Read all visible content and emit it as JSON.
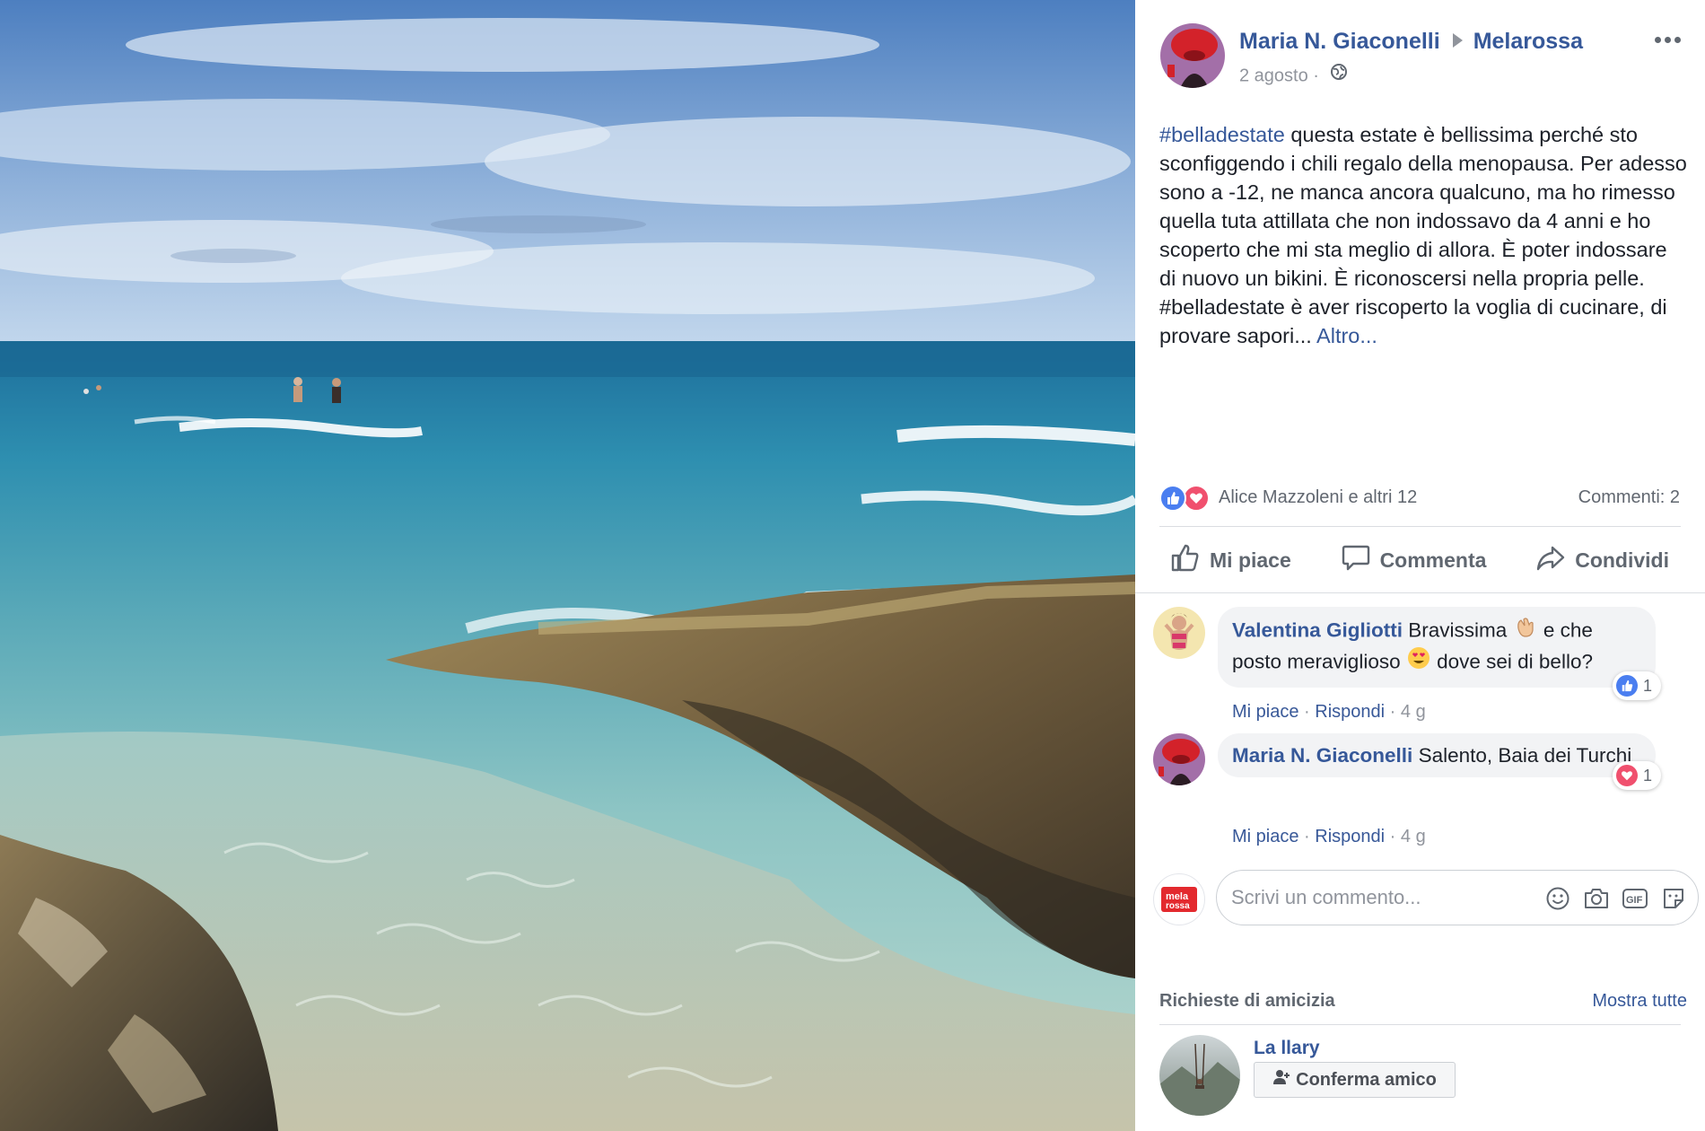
{
  "post": {
    "author": "Maria N. Giaconelli",
    "target": "Melarossa",
    "date": "2 agosto",
    "date_separator": "·",
    "text_tag1": "#belladestate",
    "text_part1": " questa estate è bellissima perché sto sconfiggendo i chili regalo della menopausa. Per adesso sono a -12, ne manca ancora qualcuno, ma ho rimesso quella tuta attillata che non indossavo da 4 anni e ho scoperto che mi sta meglio di allora. È poter indossare di nuovo un bikini. È riconoscersi nella propria pelle. #belladestate è aver riscoperto la voglia di cucinare, di provare sapori... ",
    "text_more": "Altro..."
  },
  "reactions": {
    "names": "Alice Mazzoleni e altri 12",
    "comments_count": "Commenti: 2"
  },
  "actions": {
    "like": "Mi piace",
    "comment": "Commenta",
    "share": "Condividi"
  },
  "comments": [
    {
      "author": "Valentina Gigliotti",
      "text_a": " Bravissima ",
      "text_b": " e che posto meraviglioso ",
      "text_c": " dove sei di bello?",
      "reaction_count": "1",
      "like": "Mi piace",
      "reply": "Rispondi",
      "sep": "·",
      "age": "4 g"
    },
    {
      "author": "Maria N. Giaconelli",
      "text": " Salento, Baia dei Turchi",
      "reaction_count": "1",
      "like": "Mi piace",
      "reply": "Rispondi",
      "sep": "·",
      "age": "4 g"
    }
  ],
  "write_comment": {
    "placeholder": "Scrivi un commento...",
    "brand_text": "mela rossa.it"
  },
  "friend_requests": {
    "title": "Richieste di amicizia",
    "show_all": "Mostra tutte",
    "name": "La llary",
    "confirm": "Conferma amico"
  },
  "icons": {
    "more": "more-dots-icon",
    "globe": "globe-icon",
    "like": "thumbs-up-icon",
    "love": "heart-icon",
    "comment": "speech-bubble-icon",
    "share": "share-arrow-icon",
    "emoji": "smiley-icon",
    "camera": "camera-icon",
    "gif": "gif-icon",
    "sticker": "sticker-icon",
    "add_friend": "add-friend-icon"
  },
  "colors": {
    "link_blue": "#365899",
    "like_blue": "#4a7ef0",
    "love_red": "#f0506e",
    "text": "#1d2129",
    "muted": "#90949c",
    "brand_red": "#e3292e"
  }
}
